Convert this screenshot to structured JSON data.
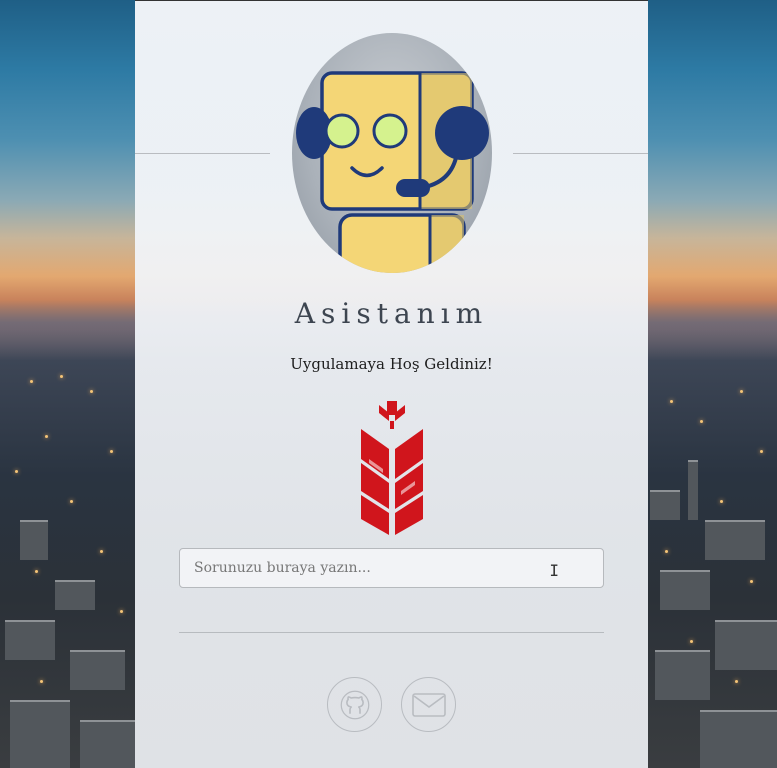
{
  "app": {
    "title": "Asistanım",
    "welcome": "Uygulamaya Hoş Geldiniz!"
  },
  "search": {
    "placeholder": "Sorunuzu buraya yazın...",
    "value": ""
  },
  "icons": {
    "avatar": "robot-headset-icon",
    "logo": "wheat-logo-icon",
    "social": [
      "github-icon",
      "mail-icon"
    ]
  },
  "colors": {
    "logo_red": "#d0151c",
    "robot_yellow": "#f4d676",
    "robot_stroke": "#1f3a7a",
    "eye_green": "#d5f28e"
  }
}
